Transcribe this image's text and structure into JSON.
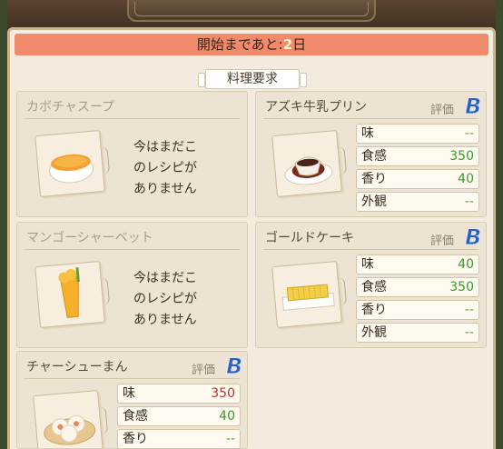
{
  "banner": {
    "prefix": "開始まであと:",
    "days": "2",
    "suffix": "日"
  },
  "requirements_tab": "料理要求",
  "eval_label": "評価",
  "grade": "B",
  "cards": [
    {
      "title": "カボチャスープ",
      "locked": true,
      "locked_lines": [
        "今はまだこ",
        "のレシピが",
        "ありません"
      ]
    },
    {
      "title": "アズキ牛乳プリン",
      "locked": false,
      "stats": [
        {
          "label": "味",
          "value": "--"
        },
        {
          "label": "食感",
          "value": "350"
        },
        {
          "label": "香り",
          "value": "40"
        },
        {
          "label": "外観",
          "value": "--"
        }
      ]
    },
    {
      "title": "マンゴーシャーベット",
      "locked": true,
      "locked_lines": [
        "今はまだこ",
        "のレシピが",
        "ありません"
      ]
    },
    {
      "title": "ゴールドケーキ",
      "locked": false,
      "stats": [
        {
          "label": "味",
          "value": "40"
        },
        {
          "label": "食感",
          "value": "350"
        },
        {
          "label": "香り",
          "value": "--"
        },
        {
          "label": "外観",
          "value": "--"
        }
      ]
    },
    {
      "title": "チャーシューまん",
      "locked": false,
      "stats": [
        {
          "label": "味",
          "value": "350"
        },
        {
          "label": "食感",
          "value": "40"
        },
        {
          "label": "香り",
          "value": "--"
        }
      ]
    }
  ],
  "colors": {
    "value_high": "#c03030",
    "value_normal": "#3a9a2a",
    "grade": "#2f5fb8"
  }
}
